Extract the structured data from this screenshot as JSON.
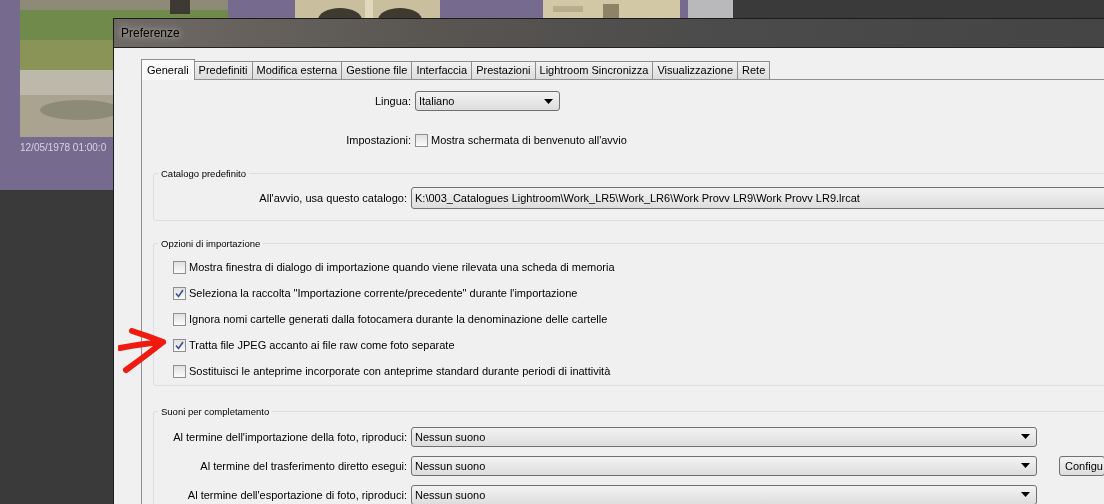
{
  "background": {
    "thumbnail_date": "12/05/1978 01:00:0"
  },
  "window": {
    "title": "Preferenze"
  },
  "tabs": [
    {
      "label": "Generali",
      "selected": true
    },
    {
      "label": "Predefiniti",
      "selected": false
    },
    {
      "label": "Modifica esterna",
      "selected": false
    },
    {
      "label": "Gestione file",
      "selected": false
    },
    {
      "label": "Interfaccia",
      "selected": false
    },
    {
      "label": "Prestazioni",
      "selected": false
    },
    {
      "label": "Lightroom Sincronizza",
      "selected": false
    },
    {
      "label": "Visualizzazione",
      "selected": false
    },
    {
      "label": "Rete",
      "selected": false
    }
  ],
  "language": {
    "label": "Lingua:",
    "value": "Italiano"
  },
  "settings": {
    "label": "Impostazioni:",
    "option": "Mostra schermata di benvenuto all'avvio",
    "checked": false
  },
  "default_catalog": {
    "title": "Catalogo predefinito",
    "label": "All'avvio, usa questo catalogo:",
    "value": "K:\\003_Catalogues Lightroom\\Work_LR5\\Work_LR6\\Work Provv LR9\\Work Provv LR9.lrcat"
  },
  "import_options": {
    "title": "Opzioni di importazione",
    "items": [
      {
        "label": "Mostra finestra di dialogo di importazione quando viene rilevata una scheda di memoria",
        "checked": false
      },
      {
        "label": "Seleziona la raccolta \"Importazione corrente/precedente\" durante l'importazione",
        "checked": true
      },
      {
        "label": "Ignora nomi cartelle generati dalla fotocamera durante la denominazione delle cartelle",
        "checked": false
      },
      {
        "label": "Tratta file JPEG accanto ai file raw come foto separate",
        "checked": true
      },
      {
        "label": "Sostituisci le anteprime incorporate con anteprime standard durante periodi di inattività",
        "checked": false
      }
    ]
  },
  "completion_sounds": {
    "title": "Suoni per completamento",
    "rows": [
      {
        "label": "Al termine dell'importazione della foto, riproduci:",
        "value": "Nessun suono"
      },
      {
        "label": "Al termine del trasferimento diretto esegui:",
        "value": "Nessun suono",
        "button": "Configu"
      },
      {
        "label": "Al termine dell'esportazione di foto, riproduci:",
        "value": "Nessun suono"
      }
    ]
  }
}
